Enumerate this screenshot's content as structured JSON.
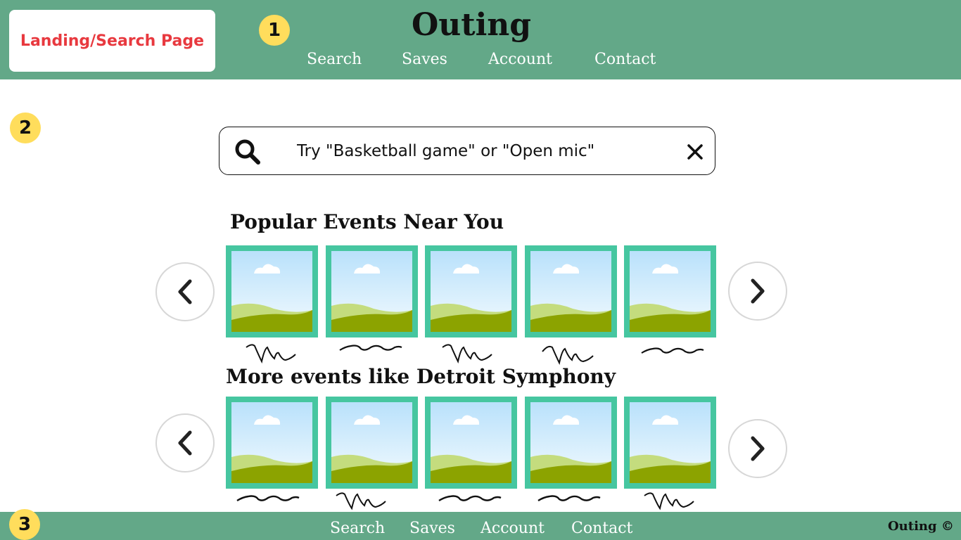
{
  "page_label": "Landing/Search Page",
  "markers": [
    "1",
    "2",
    "3"
  ],
  "app_title": "Outing",
  "nav": {
    "search": "Search",
    "saves": "Saves",
    "account": "Account",
    "contact": "Contact"
  },
  "search": {
    "placeholder": "Try \"Basketball game\" or \"Open mic\""
  },
  "sections": {
    "popular": {
      "title": "Popular Events Near You"
    },
    "similar": {
      "title": "More events like Detroit Symphony"
    }
  },
  "footer": {
    "nav": {
      "search": "Search",
      "saves": "Saves",
      "account": "Account",
      "contact": "Contact"
    },
    "copyright": "Outing ©"
  },
  "icons": {
    "search": "search-icon",
    "clear": "close-icon",
    "prev": "chevron-left-icon",
    "next": "chevron-right-icon",
    "placeholder_image": "image-placeholder-icon"
  },
  "colors": {
    "header_bg": "#63a888",
    "card_frame": "#46c6a0",
    "page_label_text": "#e8393f",
    "marker_bg": "#ffdd5c"
  }
}
